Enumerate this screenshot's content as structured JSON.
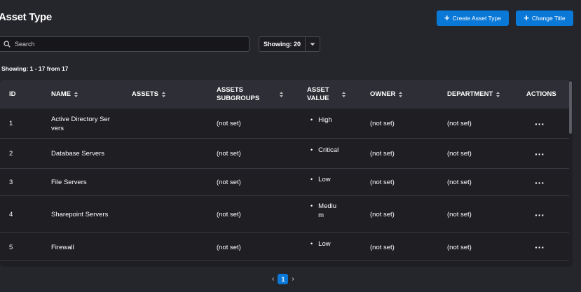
{
  "header": {
    "title": "Asset Type",
    "create_button": "Create Asset Type",
    "change_title_button": "Change Title"
  },
  "search": {
    "placeholder": "Search",
    "value": ""
  },
  "page_size": {
    "label": "Showing: 20"
  },
  "summary": "Showing: 1 - 17 from 17",
  "table": {
    "columns": {
      "id": "ID",
      "name": "NAME",
      "assets": "ASSETS",
      "subgroups_1": "ASSETS",
      "subgroups_2": "SUBGROUPS",
      "value_1": "ASSET",
      "value_2": "VALUE",
      "owner": "OWNER",
      "department": "DEPARTMENT",
      "actions": "ACTIONS"
    },
    "rows": [
      {
        "id": "1",
        "name": "Active Directory Servers",
        "assets": "",
        "subgroups": "(not set)",
        "value": "High",
        "owner": "(not set)",
        "department": "(not set)"
      },
      {
        "id": "2",
        "name": "Database Servers",
        "assets": "",
        "subgroups": "(not set)",
        "value": "Critical",
        "owner": "(not set)",
        "department": "(not set)"
      },
      {
        "id": "3",
        "name": "File Servers",
        "assets": "",
        "subgroups": "(not set)",
        "value": "Low",
        "owner": "(not set)",
        "department": "(not set)"
      },
      {
        "id": "4",
        "name": "Sharepoint Servers",
        "assets": "",
        "subgroups": "(not set)",
        "value": "Medium",
        "owner": "(not set)",
        "department": "(not set)"
      },
      {
        "id": "5",
        "name": "Firewall",
        "assets": "",
        "subgroups": "(not set)",
        "value": "Low",
        "owner": "(not set)",
        "department": "(not set)"
      }
    ]
  },
  "pagination": {
    "current": "1"
  },
  "colors": {
    "accent": "#0a78d7",
    "background": "#25252c",
    "table_bg": "#1e1e23",
    "header_bg": "#2e2e36"
  },
  "icons": [
    "plus-icon",
    "search-icon",
    "chevron-down-icon",
    "sort-icon",
    "more-horizontal-icon",
    "chevron-left-icon",
    "chevron-right-icon"
  ]
}
